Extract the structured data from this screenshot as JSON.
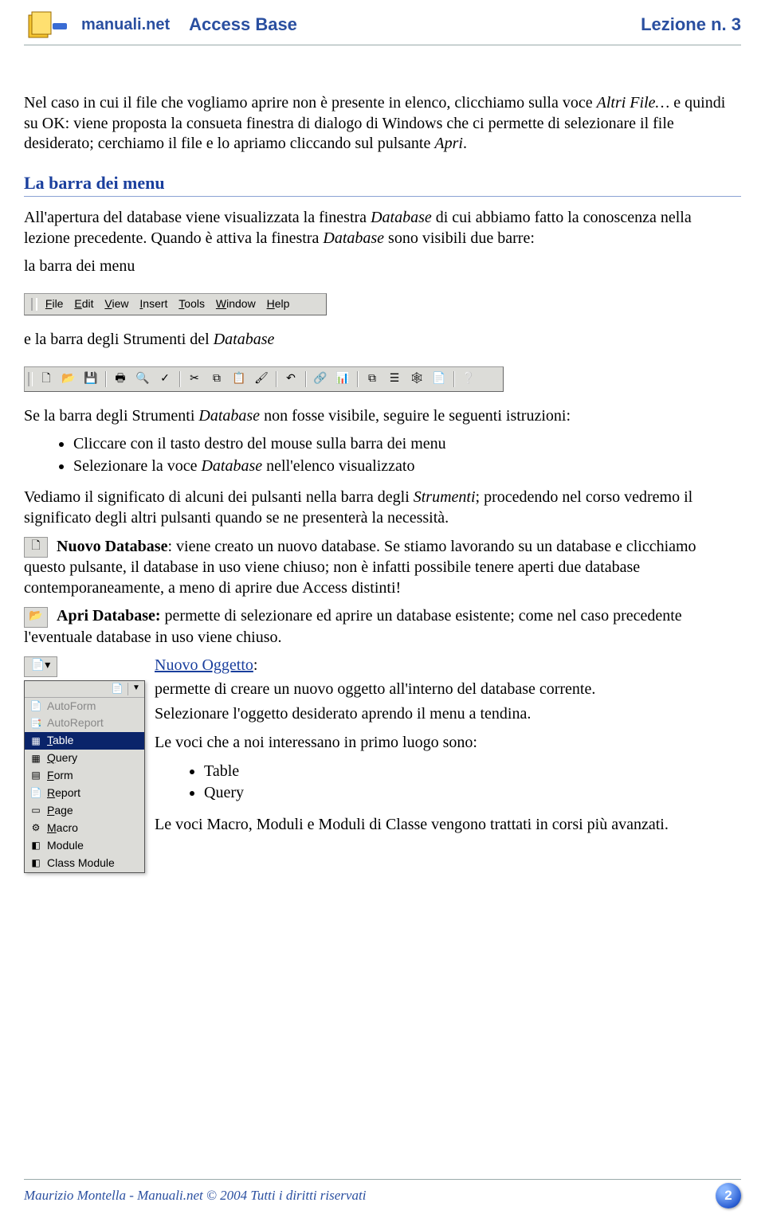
{
  "header": {
    "brand": "manuali.net",
    "course_title": "Access Base",
    "lesson_label": "Lezione n. 3"
  },
  "content": {
    "intro_para_pre": "Nel caso in cui il file che vogliamo aprire non è presente in elenco, clicchiamo sulla voce ",
    "intro_altri_file": "Altri File…",
    "intro_para_post": " e quindi su OK: viene proposta la consueta finestra di dialogo di Windows che ci permette di selezionare il file desiderato; cerchiamo il file e lo apriamo cliccando sul pulsante ",
    "intro_apri": "Apri",
    "section_menu": "La barra dei menu",
    "menu_para_pre": "All'apertura del database viene visualizzata la finestra ",
    "menu_database": "Database",
    "menu_para_mid": " di cui abbiamo fatto la conoscenza nella lezione precedente. Quando è attiva la finestra ",
    "menu_para_post": "  sono visibili due barre:",
    "menu_barra_line": "la barra dei menu",
    "menubar_items": [
      "File",
      "Edit",
      "View",
      "Insert",
      "Tools",
      "Window",
      "Help"
    ],
    "lbl_barra_strumenti": "e la barra degli Strumenti del ",
    "toolbar_icons": [
      {
        "name": "new-icon",
        "glyph": "🗋"
      },
      {
        "name": "open-icon",
        "glyph": "📂"
      },
      {
        "name": "save-icon",
        "glyph": "💾"
      },
      {
        "sep": true
      },
      {
        "name": "print-icon",
        "glyph": "🖶"
      },
      {
        "name": "print-preview-icon",
        "glyph": "🔍"
      },
      {
        "name": "spell-icon",
        "glyph": "✓"
      },
      {
        "sep": true
      },
      {
        "name": "cut-icon",
        "glyph": "✂"
      },
      {
        "name": "copy-icon",
        "glyph": "⧉"
      },
      {
        "name": "paste-icon",
        "glyph": "📋"
      },
      {
        "name": "format-painter-icon",
        "glyph": "🖌"
      },
      {
        "sep": true
      },
      {
        "name": "undo-icon",
        "glyph": "↶"
      },
      {
        "sep": true
      },
      {
        "name": "office-links-icon",
        "glyph": "🔗"
      },
      {
        "name": "analyze-icon",
        "glyph": "📊"
      },
      {
        "sep": true
      },
      {
        "name": "code-icon",
        "glyph": "⧉"
      },
      {
        "name": "properties-icon",
        "glyph": "☰"
      },
      {
        "name": "relationships-icon",
        "glyph": "🕸"
      },
      {
        "name": "newobject-icon",
        "glyph": "📄"
      },
      {
        "sep": true
      },
      {
        "name": "help-icon",
        "glyph": "❔"
      }
    ],
    "para_strum_nonvis_pre": "Se la barra degli Strumenti ",
    "para_strum_nonvis_post": " non fosse visibile, seguire le seguenti istruzioni:",
    "bullets_instr": [
      "Cliccare con il tasto destro del mouse sulla barra dei menu",
      "Selezionare la voce Database nell'elenco visualizzato"
    ],
    "bullets_instr_1_pre": "Selezionare la voce ",
    "bullets_instr_1_db": "Database",
    "bullets_instr_1_post": " nell'elenco visualizzato",
    "para_significato_pre": "Vediamo il significato di alcuni dei pulsanti nella barra degli ",
    "para_strumenti": "Strumenti",
    "para_significato_post": "; procedendo nel corso vedremo il significato degli altri pulsanti quando se ne presenterà la necessità.",
    "nuovo_db_title": " Nuovo Database",
    "nuovo_db_text": ": viene creato un nuovo database. Se stiamo lavorando su un database e clicchiamo questo pulsante, il database in uso viene chiuso; non è infatti possibile tenere aperti due database contemporaneamente, a meno di aprire due Access distinti!",
    "apri_db_title": " Apri Database:",
    "apri_db_text": " permette di selezionare ed aprire un database esistente; come nel caso precedente l'eventuale database in uso viene chiuso.",
    "nuovo_ogg_title": "Nuovo Oggetto",
    "nuovo_ogg_lines": [
      "permette di creare un nuovo oggetto all'interno del database corrente.",
      "Selezionare l'oggetto desiderato aprendo il menu a tendina.",
      "Le voci che a noi interessano in primo luogo sono:"
    ],
    "nuovo_ogg_bullets": [
      "Table",
      "Query"
    ],
    "nuovo_ogg_footer": "Le voci Macro, Moduli e Moduli di Classe vengono trattati in corsi più avanzati.",
    "dropdown": {
      "top_icon": "📄",
      "items": [
        {
          "icon": "📄",
          "label_u": "",
          "label": "AutoForm",
          "disabled": true,
          "name": "autoform"
        },
        {
          "icon": "📑",
          "label_u": "",
          "label": "AutoReport",
          "disabled": true,
          "name": "autoreport"
        },
        {
          "icon": "▦",
          "label_u": "T",
          "label": "able",
          "selected": true,
          "name": "table"
        },
        {
          "icon": "▦",
          "label_u": "Q",
          "label": "uery",
          "name": "query"
        },
        {
          "icon": "▤",
          "label_u": "F",
          "label": "orm",
          "name": "form"
        },
        {
          "icon": "📄",
          "label_u": "R",
          "label": "eport",
          "name": "report"
        },
        {
          "icon": "▭",
          "label_u": "P",
          "label": "age",
          "name": "page"
        },
        {
          "icon": "⚙",
          "label_u": "M",
          "label": "acro",
          "name": "macro"
        },
        {
          "icon": "◧",
          "label_u": "",
          "label": "Module",
          "name": "module"
        },
        {
          "icon": "◧",
          "label_u": "",
          "label": "Class Module",
          "name": "class-module"
        }
      ]
    }
  },
  "footer": {
    "left": "Maurizio Montella  - Manuali.net © 2004  Tutti i diritti riservati",
    "page": "2"
  }
}
